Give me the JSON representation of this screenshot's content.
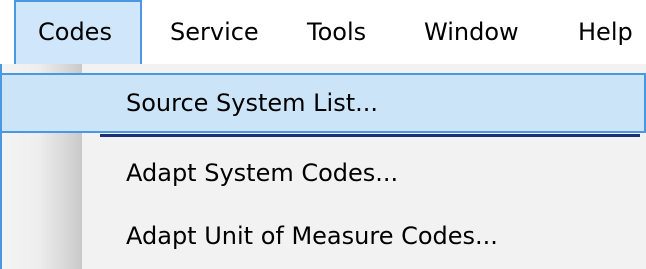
{
  "menubar": {
    "items": [
      {
        "label": "Codes",
        "active": true
      },
      {
        "label": "Service"
      },
      {
        "label": "Tools"
      },
      {
        "label": "Window"
      },
      {
        "label": "Help"
      }
    ]
  },
  "codes_menu": {
    "items": [
      {
        "label": "Source System List...",
        "highlighted": true
      },
      {
        "label": "Adapt System Codes..."
      },
      {
        "label": "Adapt Unit of Measure Codes..."
      }
    ]
  },
  "colors": {
    "accent_border": "#4b98e0",
    "highlight_fill": "#cce4f8",
    "separator": "#1e2f7a"
  }
}
